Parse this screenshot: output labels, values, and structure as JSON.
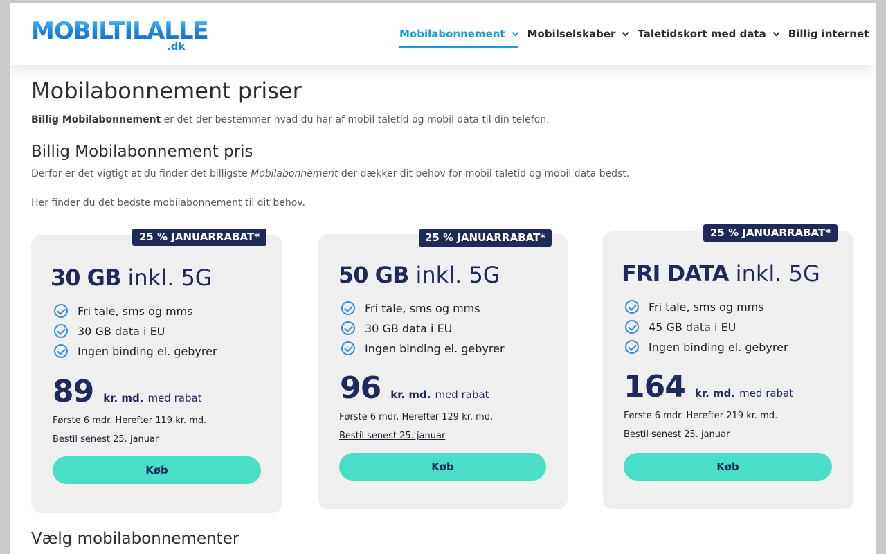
{
  "header": {
    "logo_text": "MOBILTILALLE",
    "logo_sub": ".dk",
    "nav": [
      {
        "label": "Mobilabonnement",
        "active": true
      },
      {
        "label": "Mobilselskaber",
        "active": false
      },
      {
        "label": "Taletidskort med data",
        "active": false
      },
      {
        "label": "Billig internet",
        "active": false
      }
    ]
  },
  "main": {
    "title": "Mobilabonnement priser",
    "intro_bold": "Billig Mobilabonnement",
    "intro_rest": " er det der bestemmer hvad du har af mobil taletid og mobil data til din telefon.",
    "subheading": "Billig Mobilabonnement pris",
    "p2_a": "Derfor er det vigtigt at du finder det billigste ",
    "p2_em": "Mobilabonnement",
    "p2_b": " der dækker dit behov for mobil taletid og mobil data bedst.",
    "p3": "Her finder du det bedste mobilabonnement til dit behov.",
    "section2": "Vælg mobilabonnementer"
  },
  "cards": [
    {
      "badge": "25 % JANUARRABAT*",
      "plan_bold": "30 GB",
      "plan_rest": " inkl. 5G",
      "features": [
        "Fri tale, sms og mms",
        "30 GB data i EU",
        "Ingen binding el. gebyrer"
      ],
      "price": "89",
      "unit": "kr. md.",
      "rabat": "med rabat",
      "after": "Første 6 mdr. Herefter 119 kr. md.",
      "order_by": "Bestil senest 25. januar",
      "buy": "Køb"
    },
    {
      "badge": "25 % JANUARRABAT*",
      "plan_bold": "50 GB",
      "plan_rest": " inkl. 5G",
      "features": [
        "Fri tale, sms og mms",
        "30 GB data i EU",
        "Ingen binding el. gebyrer"
      ],
      "price": "96",
      "unit": "kr. md.",
      "rabat": "med rabat",
      "after": "Første 6 mdr. Herefter 129 kr. md.",
      "order_by": "Bestil senest 25. januar",
      "buy": "Køb"
    },
    {
      "badge": "25 % JANUARRABAT*",
      "plan_bold": "FRI DATA",
      "plan_rest": " inkl. 5G",
      "features": [
        "Fri tale, sms og mms",
        "45 GB data i EU",
        "Ingen binding el. gebyrer"
      ],
      "price": "164",
      "unit": "kr. md.",
      "rabat": "med rabat",
      "after": "Første 6 mdr. Herefter 219 kr. md.",
      "order_by": "Bestil senest 25. januar",
      "buy": "Køb"
    }
  ],
  "colors": {
    "accent": "#1a9be0",
    "navy": "#1f2a5a",
    "mint": "#48dfc6",
    "card_bg": "#efeff0"
  }
}
